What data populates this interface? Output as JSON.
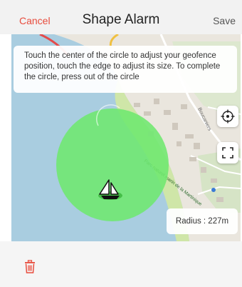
{
  "header": {
    "cancel_label": "Cancel",
    "title": "Shape Alarm",
    "save_label": "Save"
  },
  "map": {
    "hint_text": "Touch the center of the circle to adjust your geofence position, touch the edge to adjust its size. To complete the circle, press out of the circle",
    "radius_text": "Radius : 227m",
    "street_labels": [
      "Boucaniers",
      "Parc naturel marin de la Martinique"
    ],
    "geofence_color": "#6ee86e",
    "center_icon": "sailboat-icon"
  },
  "controls": {
    "locate_icon": "crosshair-icon",
    "fullscreen_icon": "fullscreen-icon"
  },
  "footer": {
    "delete_icon": "trash-icon",
    "delete_color": "#e84c3d"
  }
}
